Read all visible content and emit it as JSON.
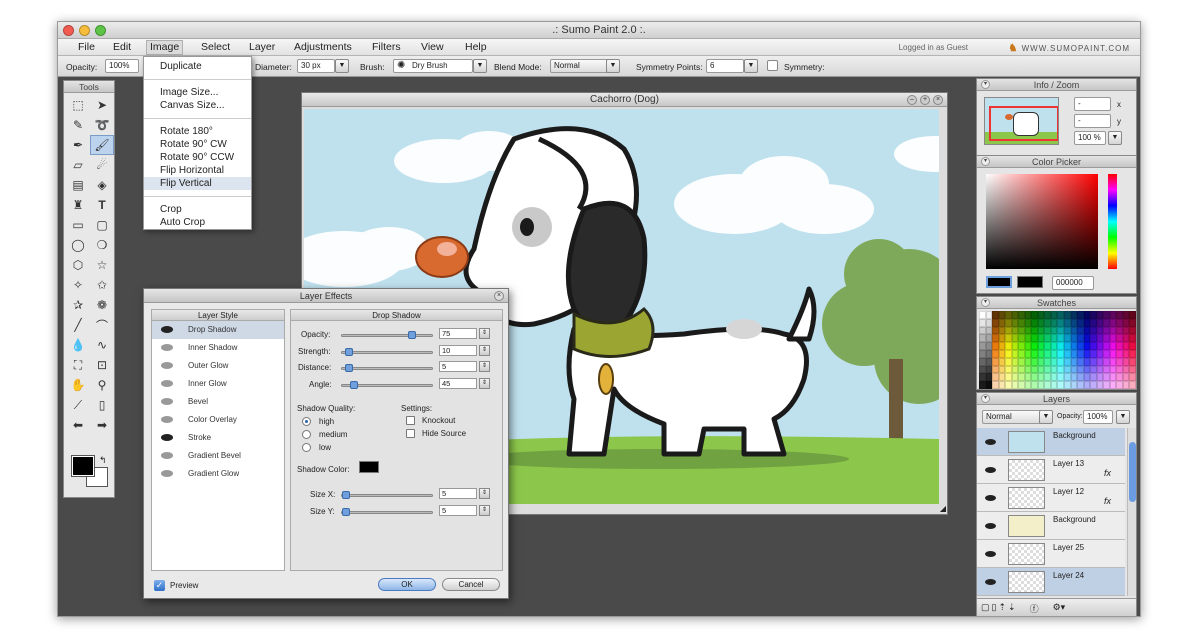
{
  "window": {
    "title": ".: Sumo Paint 2.0 :."
  },
  "menubar": {
    "items": [
      "File",
      "Edit",
      "Image",
      "Select",
      "Layer",
      "Adjustments",
      "Filters",
      "View",
      "Help"
    ],
    "login_text": "Logged in as Guest",
    "brand": "WWW.SUMOPAINT.COM"
  },
  "options": {
    "opacity_label": "Opacity:",
    "opacity_value": "100%",
    "diameter_label": "Diameter:",
    "diameter_value": "30 px",
    "brush_label": "Brush:",
    "brush_value": "Dry Brush",
    "blend_label": "Blend Mode:",
    "blend_value": "Normal",
    "symmetry_points_label": "Symmetry Points:",
    "symmetry_points_value": "6",
    "symmetry_label": "Symmetry:"
  },
  "image_menu": {
    "items": [
      "Duplicate",
      "Image Size...",
      "Canvas Size...",
      "Rotate 180°",
      "Rotate 90° CW",
      "Rotate 90° CCW",
      "Flip Horizontal",
      "Flip Vertical",
      "Crop",
      "Auto Crop"
    ],
    "highlighted": "Flip Vertical"
  },
  "tools": {
    "title": "Tools"
  },
  "document": {
    "title": "Cachorro (Dog)"
  },
  "layer_effects": {
    "title": "Layer Effects",
    "style_header": "Layer Style",
    "styles": [
      "Drop Shadow",
      "Inner Shadow",
      "Outer Glow",
      "Inner Glow",
      "Bevel",
      "Color Overlay",
      "Stroke",
      "Gradient Bevel",
      "Gradient Glow"
    ],
    "enabled_styles": [
      "Drop Shadow",
      "Stroke"
    ],
    "drop_shadow": {
      "header": "Drop Shadow",
      "opacity_label": "Opacity:",
      "opacity": "75",
      "strength_label": "Strength:",
      "strength": "10",
      "distance_label": "Distance:",
      "distance": "5",
      "angle_label": "Angle:",
      "angle": "45",
      "quality_label": "Shadow Quality:",
      "quality_options": [
        "high",
        "medium",
        "low"
      ],
      "quality_selected": "high",
      "settings_label": "Settings:",
      "knockout_label": "Knockout",
      "hide_source_label": "Hide Source",
      "shadow_color_label": "Shadow Color:",
      "shadow_color": "#000000",
      "sizex_label": "Size X:",
      "sizex": "5",
      "sizey_label": "Size Y:",
      "sizey": "5"
    },
    "preview_label": "Preview",
    "ok_label": "OK",
    "cancel_label": "Cancel"
  },
  "info_zoom": {
    "title": "Info / Zoom",
    "x_label": "x",
    "y_label": "y",
    "zoom": "100 %",
    "x_value": "-",
    "y_value": "-"
  },
  "color_picker": {
    "title": "Color Picker",
    "hex": "000000"
  },
  "swatches": {
    "title": "Swatches"
  },
  "layers": {
    "title": "Layers",
    "blend": "Normal",
    "opacity_label": "Opacity:",
    "opacity": "100%",
    "items": [
      {
        "name": "Background",
        "fx": ""
      },
      {
        "name": "Layer 13",
        "fx": "fx"
      },
      {
        "name": "Layer 12",
        "fx": "fx"
      },
      {
        "name": "Background",
        "fx": ""
      },
      {
        "name": "Layer 25",
        "fx": ""
      },
      {
        "name": "Layer 24",
        "fx": ""
      }
    ]
  }
}
